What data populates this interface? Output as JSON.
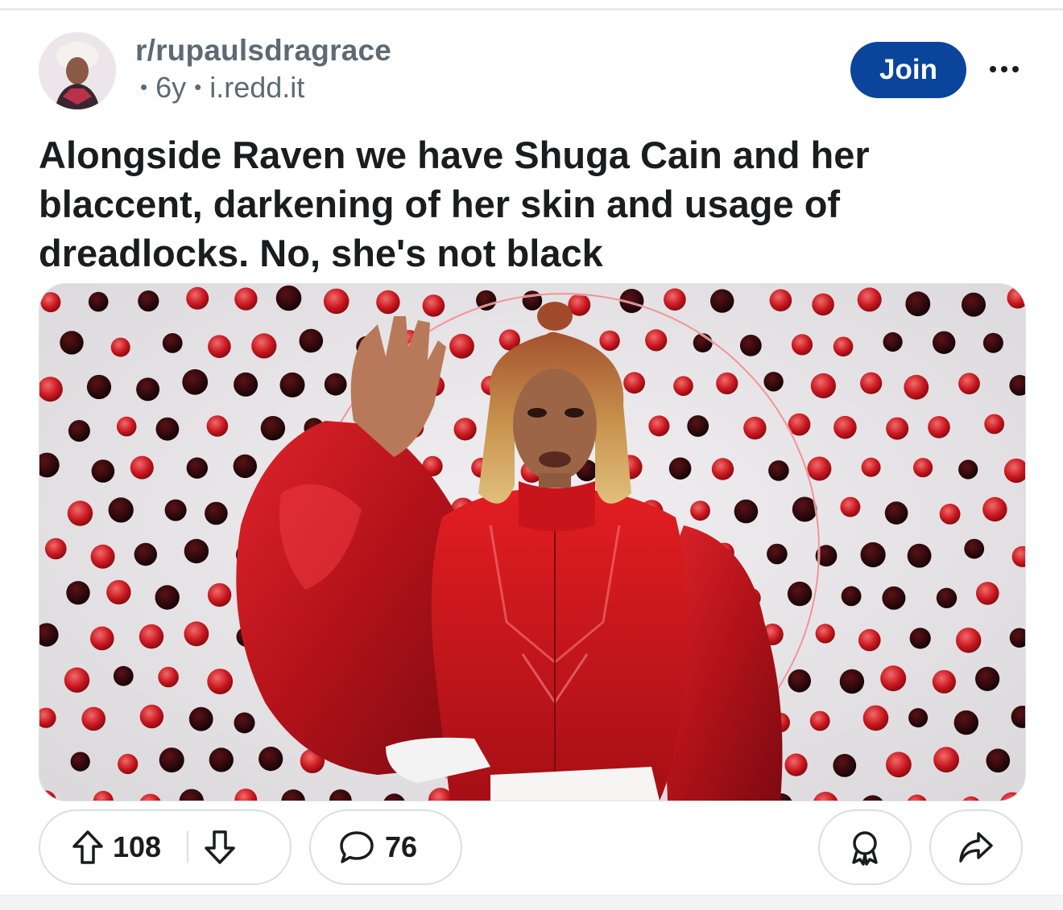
{
  "post": {
    "subreddit": "r/rupaulsdragrace",
    "age": "6y",
    "domain": "i.redd.it",
    "join_label": "Join",
    "title": "Alongside Raven we have Shuga Cain and her blaccent, darkening of her skin and usage of dreadlocks. No, she's not black"
  },
  "actions": {
    "upvotes": "108",
    "comments": "76"
  },
  "icons": {
    "avatar": "subreddit-avatar",
    "more": "more-options-icon",
    "upvote": "upvote-arrow-icon",
    "downvote": "downvote-arrow-icon",
    "comment": "comment-bubble-icon",
    "award": "award-icon",
    "share": "share-arrow-icon"
  },
  "colors": {
    "join_button": "#0a449b",
    "meta_text": "#5d6a73",
    "title_text": "#1a1c1e"
  }
}
